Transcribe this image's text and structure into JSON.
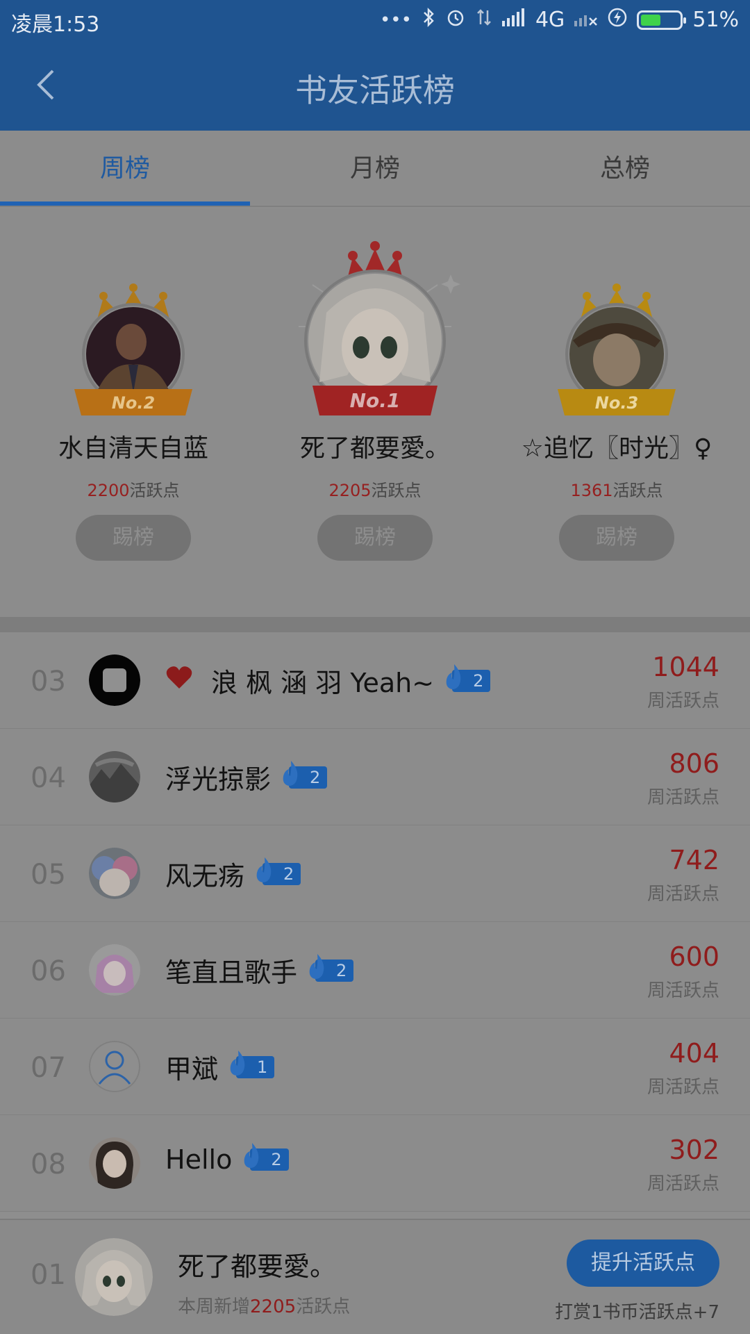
{
  "status_bar": {
    "time": "凌晨1:53",
    "network": "4G",
    "battery": "51%",
    "battery_level": 0.51
  },
  "header": {
    "title": "书友活跃榜",
    "back_icon": "chevron-left-icon"
  },
  "tabs": [
    {
      "label": "周榜",
      "active": true
    },
    {
      "label": "月榜",
      "active": false
    },
    {
      "label": "总榜",
      "active": false
    }
  ],
  "podium": {
    "second": {
      "badge": "No.2",
      "name": "水自清天自蓝",
      "score": "2200",
      "score_suffix": "活跃点",
      "button": "踢榜"
    },
    "first": {
      "badge": "No.1",
      "name": "死了都要愛。",
      "score": "2205",
      "score_suffix": "活跃点",
      "button": "踢榜"
    },
    "third": {
      "badge": "No.3",
      "name": "☆追忆〖时光〗♀",
      "score": "1361",
      "score_suffix": "活跃点",
      "button": "踢榜"
    }
  },
  "ranking_list": [
    {
      "rank": "03",
      "name": "浪 枫 涵 羽 Yeah~",
      "heart": true,
      "level": "2",
      "points": "1044",
      "points_label": "周活跃点"
    },
    {
      "rank": "04",
      "name": "浮光掠影",
      "heart": false,
      "level": "2",
      "points": "806",
      "points_label": "周活跃点"
    },
    {
      "rank": "05",
      "name": "风无疡",
      "heart": false,
      "level": "2",
      "points": "742",
      "points_label": "周活跃点"
    },
    {
      "rank": "06",
      "name": "笔直且歌手",
      "heart": false,
      "level": "2",
      "points": "600",
      "points_label": "周活跃点"
    },
    {
      "rank": "07",
      "name": "甲斌",
      "heart": false,
      "level": "1",
      "points": "404",
      "points_label": "周活跃点"
    },
    {
      "rank": "08",
      "name": "Hello",
      "heart": false,
      "level": "2",
      "points": "302",
      "points_label": "周活跃点"
    }
  ],
  "my_rank": {
    "rank": "01",
    "name": "死了都要愛。",
    "sub_prefix": "本周新增",
    "sub_value": "2205",
    "sub_suffix": "活跃点",
    "button": "提升活跃点",
    "hint": "打赏1书币活跃点+7"
  },
  "colors": {
    "header": "#1f5490",
    "accent": "#2062b3",
    "points": "#8f1c1c",
    "crown_gold": "#c8891c",
    "crown_red": "#b22a2a"
  }
}
